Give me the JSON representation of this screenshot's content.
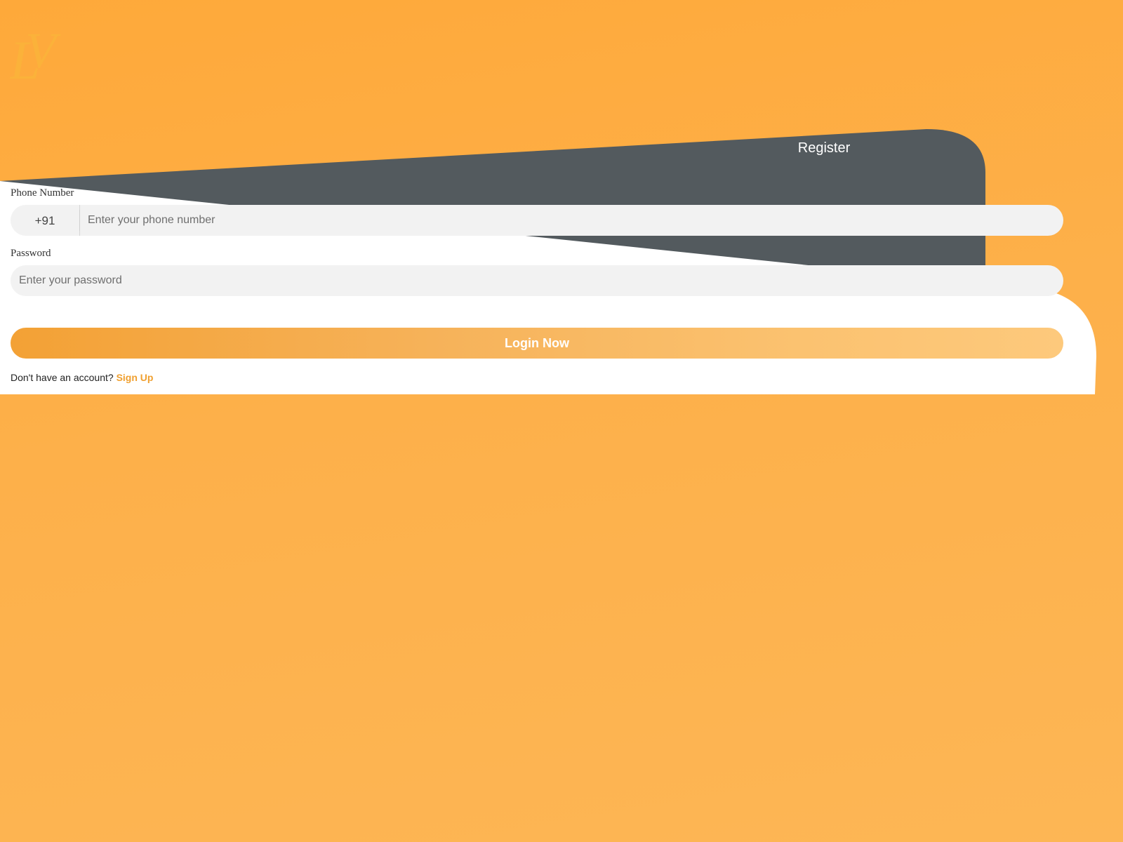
{
  "colors": {
    "background_start": "#fea93a",
    "background_end": "#fdb655",
    "tab_dark": "#535a5e",
    "card_white": "#ffffff",
    "input_background": "#f2f2f2",
    "accent": "#f0a030"
  },
  "icons": {
    "logo": "lv-monogram-icon"
  },
  "tabs": {
    "register_label": "Register"
  },
  "form": {
    "phone": {
      "label": "Phone Number",
      "country_code": "+91",
      "value": "",
      "placeholder": "Enter your phone number"
    },
    "password": {
      "label": "Password",
      "value": "",
      "placeholder": "Enter your password"
    },
    "submit_label": "Login Now",
    "signup_prompt": "Don't have an account?",
    "signup_link": "Sign Up"
  }
}
